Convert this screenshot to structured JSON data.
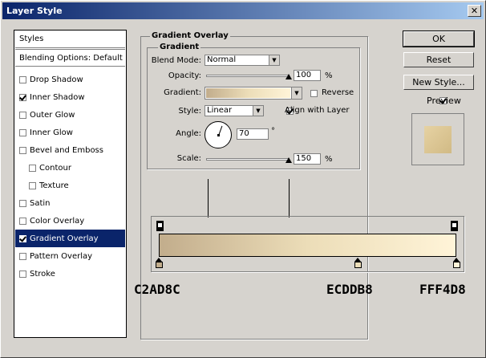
{
  "window": {
    "title": "Layer Style",
    "close_glyph": "✕"
  },
  "styles_panel": {
    "header": "Styles",
    "blending": "Blending Options: Default",
    "items": [
      {
        "label": "Drop Shadow",
        "checked": false
      },
      {
        "label": "Inner Shadow",
        "checked": true
      },
      {
        "label": "Outer Glow",
        "checked": false
      },
      {
        "label": "Inner Glow",
        "checked": false
      },
      {
        "label": "Bevel and Emboss",
        "checked": false
      },
      {
        "label": "Contour",
        "checked": false
      },
      {
        "label": "Texture",
        "checked": false
      },
      {
        "label": "Satin",
        "checked": false
      },
      {
        "label": "Color Overlay",
        "checked": false
      },
      {
        "label": "Gradient Overlay",
        "checked": true,
        "selected": true
      },
      {
        "label": "Pattern Overlay",
        "checked": false
      },
      {
        "label": "Stroke",
        "checked": false
      }
    ]
  },
  "gradient_overlay": {
    "outer_legend": "Gradient Overlay",
    "inner_legend": "Gradient",
    "blend_mode_label": "Blend Mode:",
    "blend_mode_value": "Normal",
    "opacity_label": "Opacity:",
    "opacity_value": "100",
    "opacity_unit": "%",
    "opacity_level": 1.0,
    "gradient_label": "Gradient:",
    "reverse_label": "Reverse",
    "reverse_checked": false,
    "style_label": "Style:",
    "style_value": "Linear",
    "align_label": "Align with Layer",
    "align_checked": true,
    "angle_label": "Angle:",
    "angle_value": "70",
    "angle_unit": "°",
    "scale_label": "Scale:",
    "scale_value": "150",
    "scale_unit": "%",
    "scale_level": 1.0
  },
  "buttons": {
    "ok": "OK",
    "reset": "Reset",
    "new_style": "New Style...",
    "preview": "Preview",
    "preview_checked": true
  },
  "gradient_stops": [
    {
      "hex": "C2AD8C",
      "color": "#c2ad8c",
      "location": 0.0
    },
    {
      "hex": "ECDDB8",
      "color": "#ecddb8",
      "location": 0.67
    },
    {
      "hex": "FFF4D8",
      "color": "#fff4d8",
      "location": 1.0
    }
  ],
  "colors": {
    "selection": "#0a246a",
    "dialog_bg": "#d6d3ce"
  }
}
